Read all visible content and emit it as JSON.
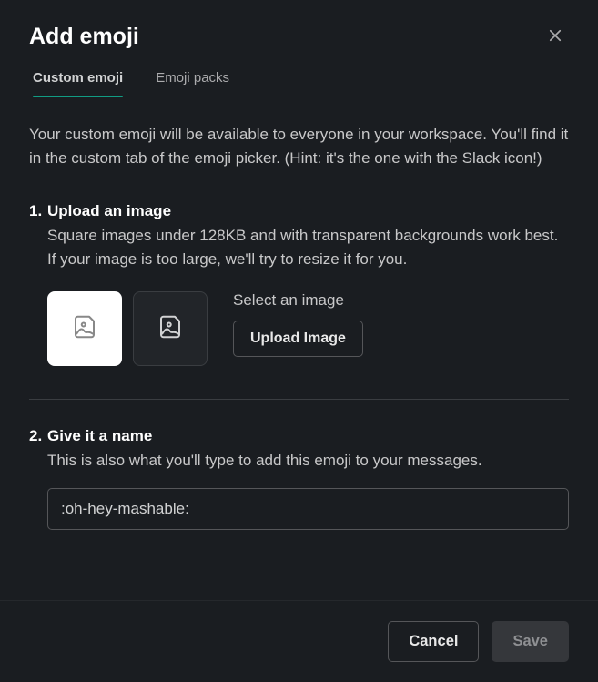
{
  "title": "Add emoji",
  "tabs": [
    {
      "label": "Custom emoji",
      "active": true
    },
    {
      "label": "Emoji packs",
      "active": false
    }
  ],
  "description": "Your custom emoji will be available to everyone in your workspace. You'll find it in the custom tab of the emoji picker. (Hint: it's the one with the Slack icon!)",
  "step1": {
    "number": "1.",
    "title": "Upload an image",
    "desc": "Square images under 128KB and with transparent backgrounds work best. If your image is too large, we'll try to resize it for you.",
    "select_label": "Select an image",
    "upload_button": "Upload Image"
  },
  "step2": {
    "number": "2.",
    "title": "Give it a name",
    "desc": "This is also what you'll type to add this emoji to your messages.",
    "input_value": ":oh-hey-mashable:"
  },
  "footer": {
    "cancel": "Cancel",
    "save": "Save"
  }
}
